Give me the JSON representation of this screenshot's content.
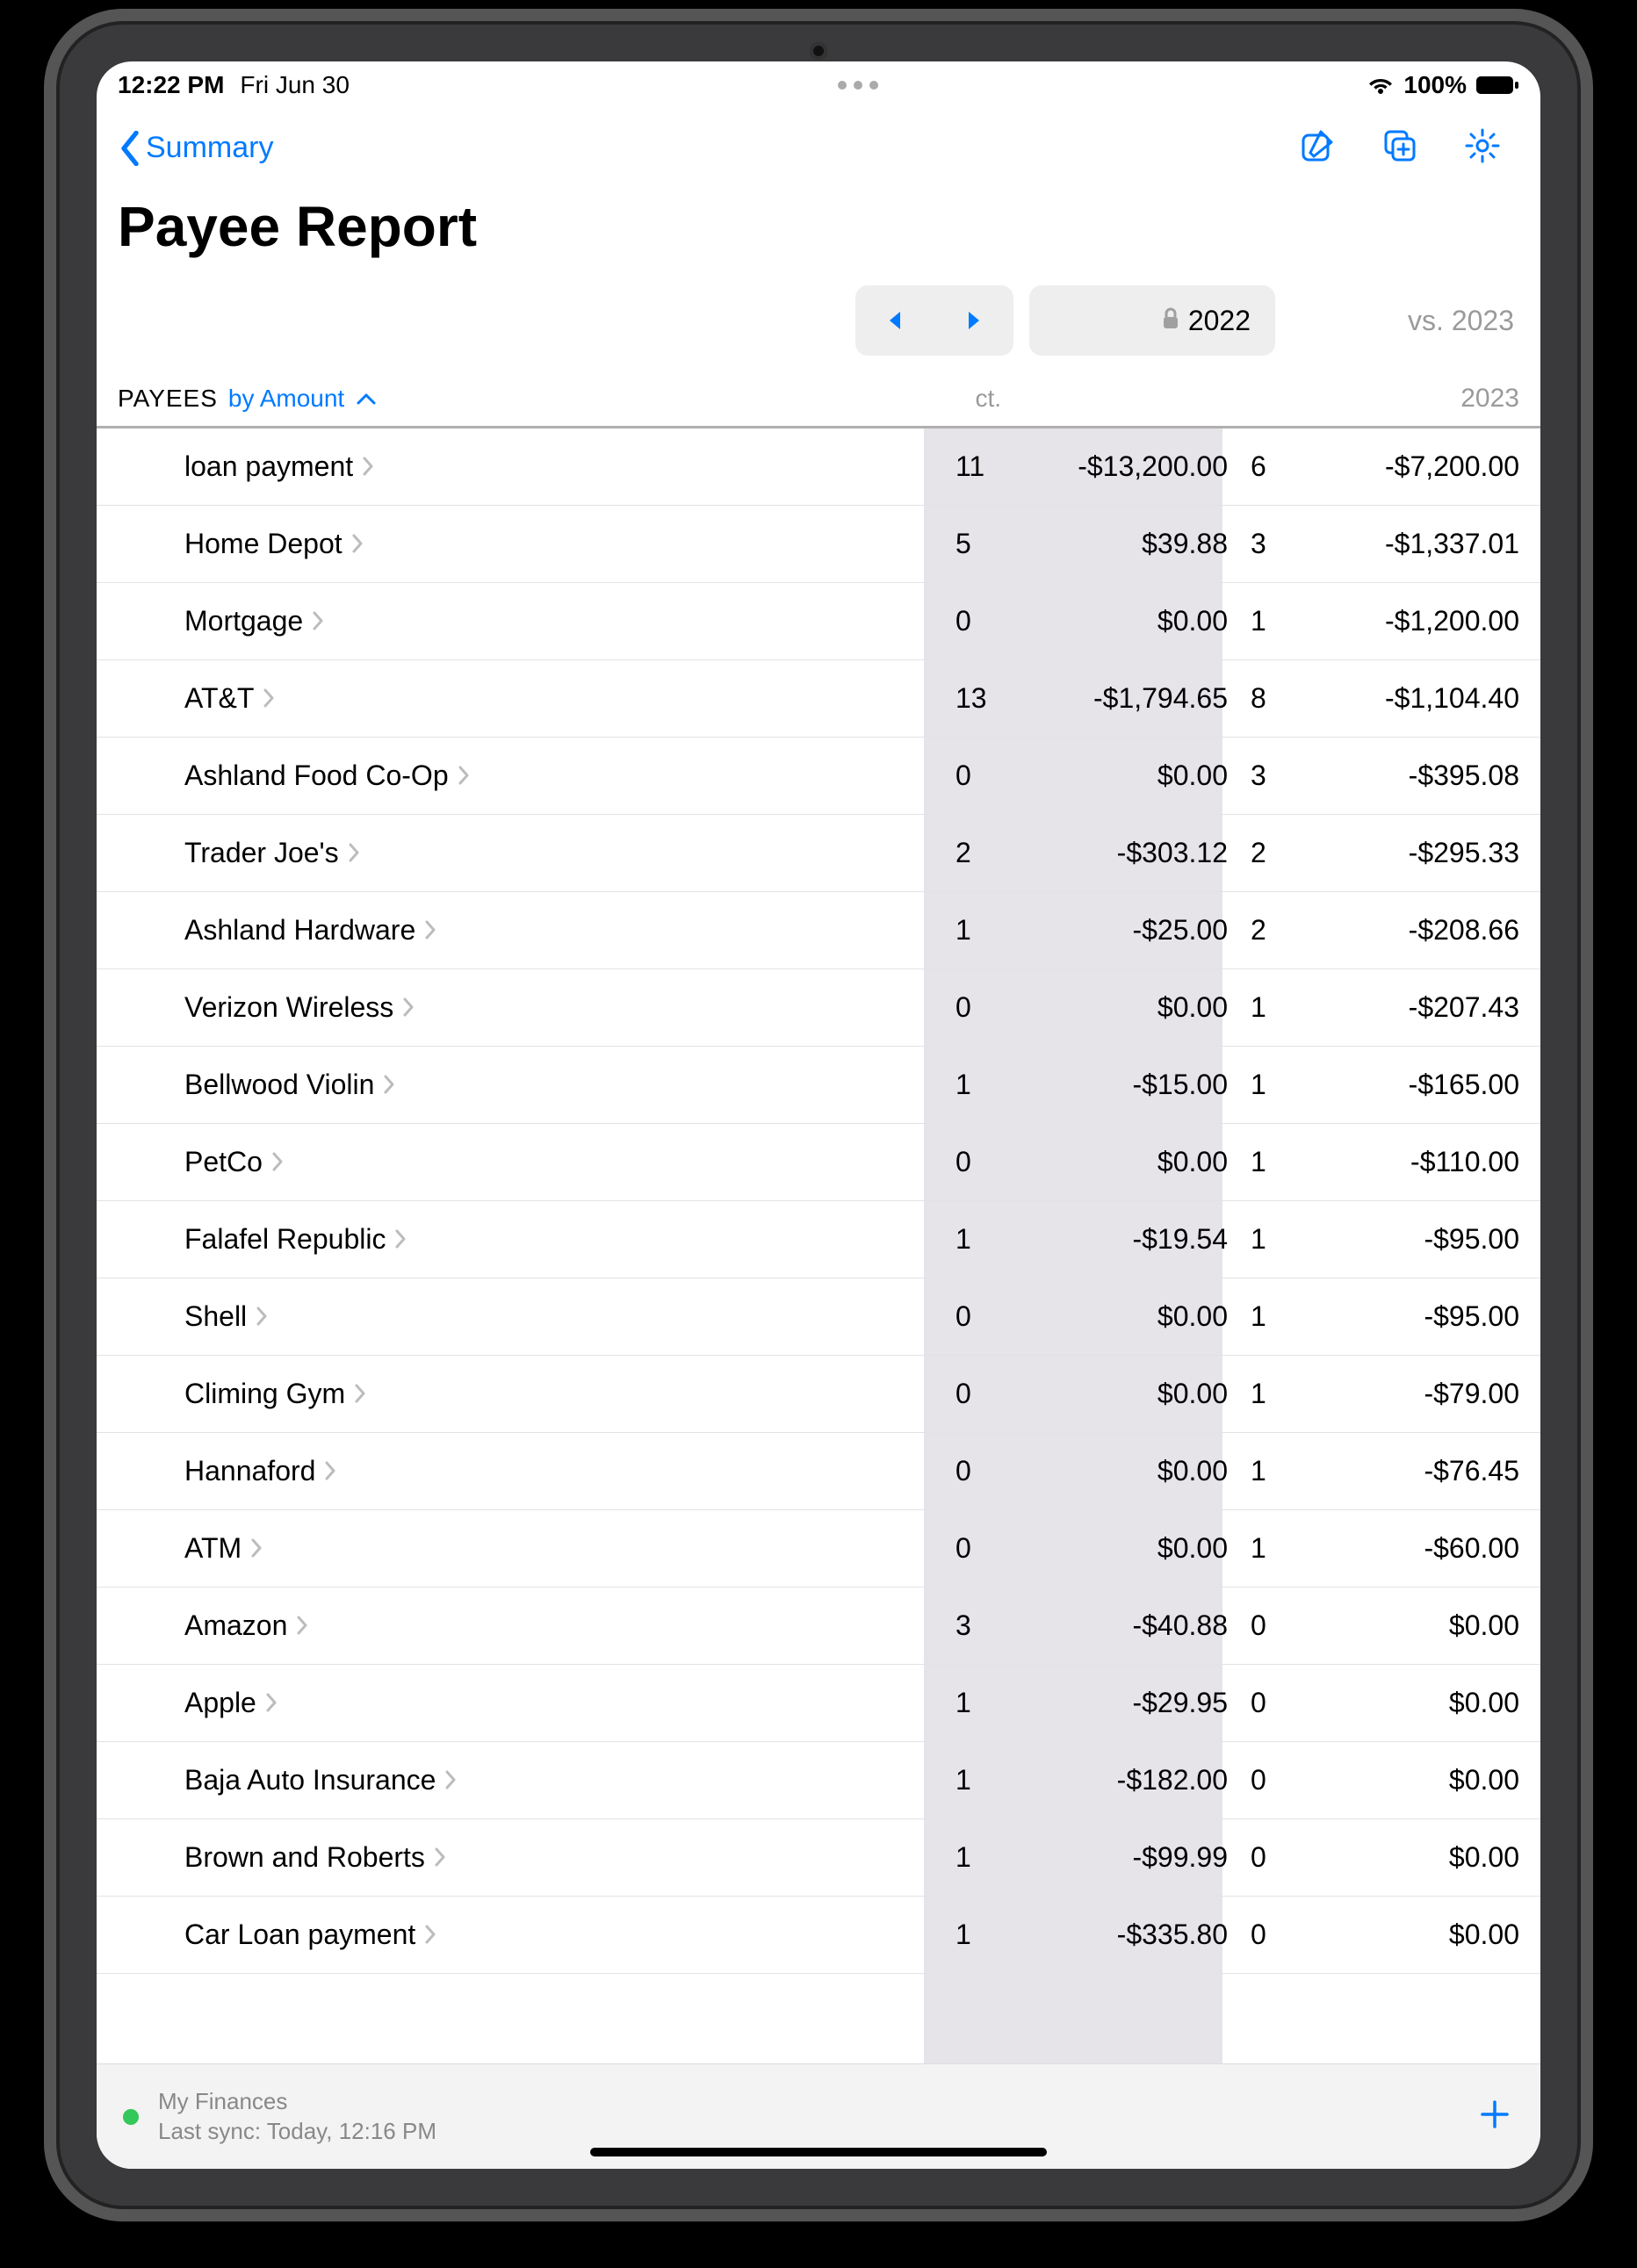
{
  "status": {
    "time": "12:22 PM",
    "date": "Fri Jun 30",
    "battery": "100%"
  },
  "nav": {
    "back_label": "Summary"
  },
  "title": "Payee Report",
  "year_selector": {
    "current": "2022",
    "vs_label": "vs. 2023"
  },
  "columns": {
    "label": "PAYEES",
    "sort": "by Amount",
    "ct": "ct.",
    "compare_year": "2023"
  },
  "rows": [
    {
      "name": "loan payment",
      "ct_2022": "11",
      "amt_2022": "-$13,200.00",
      "ct_2023": "6",
      "amt_2023": "-$7,200.00"
    },
    {
      "name": "Home Depot",
      "ct_2022": "5",
      "amt_2022": "$39.88",
      "ct_2023": "3",
      "amt_2023": "-$1,337.01"
    },
    {
      "name": "Mortgage",
      "ct_2022": "0",
      "amt_2022": "$0.00",
      "ct_2023": "1",
      "amt_2023": "-$1,200.00"
    },
    {
      "name": "AT&T",
      "ct_2022": "13",
      "amt_2022": "-$1,794.65",
      "ct_2023": "8",
      "amt_2023": "-$1,104.40"
    },
    {
      "name": "Ashland Food Co-Op",
      "ct_2022": "0",
      "amt_2022": "$0.00",
      "ct_2023": "3",
      "amt_2023": "-$395.08"
    },
    {
      "name": "Trader Joe's",
      "ct_2022": "2",
      "amt_2022": "-$303.12",
      "ct_2023": "2",
      "amt_2023": "-$295.33"
    },
    {
      "name": "Ashland Hardware",
      "ct_2022": "1",
      "amt_2022": "-$25.00",
      "ct_2023": "2",
      "amt_2023": "-$208.66"
    },
    {
      "name": "Verizon Wireless",
      "ct_2022": "0",
      "amt_2022": "$0.00",
      "ct_2023": "1",
      "amt_2023": "-$207.43"
    },
    {
      "name": "Bellwood Violin",
      "ct_2022": "1",
      "amt_2022": "-$15.00",
      "ct_2023": "1",
      "amt_2023": "-$165.00"
    },
    {
      "name": "PetCo",
      "ct_2022": "0",
      "amt_2022": "$0.00",
      "ct_2023": "1",
      "amt_2023": "-$110.00"
    },
    {
      "name": "Falafel Republic",
      "ct_2022": "1",
      "amt_2022": "-$19.54",
      "ct_2023": "1",
      "amt_2023": "-$95.00"
    },
    {
      "name": "Shell",
      "ct_2022": "0",
      "amt_2022": "$0.00",
      "ct_2023": "1",
      "amt_2023": "-$95.00"
    },
    {
      "name": "Climing Gym",
      "ct_2022": "0",
      "amt_2022": "$0.00",
      "ct_2023": "1",
      "amt_2023": "-$79.00"
    },
    {
      "name": "Hannaford",
      "ct_2022": "0",
      "amt_2022": "$0.00",
      "ct_2023": "1",
      "amt_2023": "-$76.45"
    },
    {
      "name": "ATM",
      "ct_2022": "0",
      "amt_2022": "$0.00",
      "ct_2023": "1",
      "amt_2023": "-$60.00"
    },
    {
      "name": "Amazon",
      "ct_2022": "3",
      "amt_2022": "-$40.88",
      "ct_2023": "0",
      "amt_2023": "$0.00"
    },
    {
      "name": "Apple",
      "ct_2022": "1",
      "amt_2022": "-$29.95",
      "ct_2023": "0",
      "amt_2023": "$0.00"
    },
    {
      "name": "Baja Auto Insurance",
      "ct_2022": "1",
      "amt_2022": "-$182.00",
      "ct_2023": "0",
      "amt_2023": "$0.00"
    },
    {
      "name": "Brown and Roberts",
      "ct_2022": "1",
      "amt_2022": "-$99.99",
      "ct_2023": "0",
      "amt_2023": "$0.00"
    },
    {
      "name": "Car  Loan payment",
      "ct_2022": "1",
      "amt_2022": "-$335.80",
      "ct_2023": "0",
      "amt_2023": "$0.00"
    }
  ],
  "footer": {
    "doc_name": "My Finances",
    "sync": "Last sync: Today, 12:16 PM"
  }
}
